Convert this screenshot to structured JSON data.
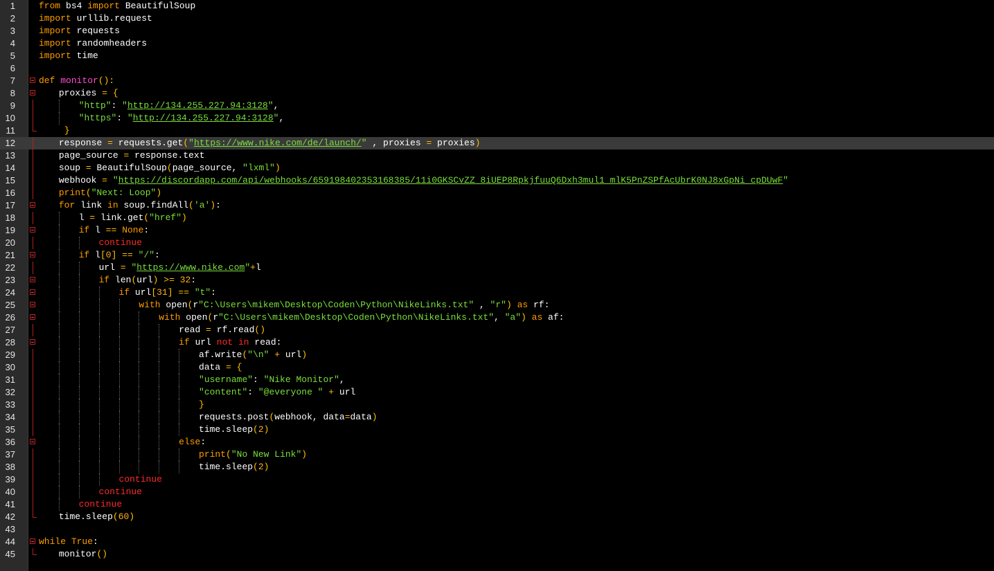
{
  "editor": {
    "current_line": 12,
    "lines": [
      {
        "n": "1",
        "indent": 0,
        "fold": "",
        "tokens": [
          [
            "kw",
            "from"
          ],
          [
            "p",
            " bs4 "
          ],
          [
            "kw",
            "import"
          ],
          [
            "p",
            " BeautifulSoup"
          ]
        ]
      },
      {
        "n": "2",
        "indent": 0,
        "fold": "",
        "tokens": [
          [
            "kw",
            "import"
          ],
          [
            "p",
            " urllib.request"
          ]
        ]
      },
      {
        "n": "3",
        "indent": 0,
        "fold": "",
        "tokens": [
          [
            "kw",
            "import"
          ],
          [
            "p",
            " requests"
          ]
        ]
      },
      {
        "n": "4",
        "indent": 0,
        "fold": "",
        "tokens": [
          [
            "kw",
            "import"
          ],
          [
            "p",
            " randomheaders"
          ]
        ]
      },
      {
        "n": "5",
        "indent": 0,
        "fold": "",
        "tokens": [
          [
            "kw",
            "import"
          ],
          [
            "p",
            " time"
          ]
        ]
      },
      {
        "n": "6",
        "indent": 0,
        "fold": "",
        "tokens": []
      },
      {
        "n": "7",
        "indent": 0,
        "fold": "open",
        "tokens": [
          [
            "kw",
            "def"
          ],
          [
            "p",
            " "
          ],
          [
            "fn",
            "monitor"
          ],
          [
            "br",
            "():"
          ]
        ]
      },
      {
        "n": "8",
        "indent": 1,
        "fold": "open",
        "tokens": [
          [
            "p",
            "proxies "
          ],
          [
            "op",
            "="
          ],
          [
            "p",
            " "
          ],
          [
            "br",
            "{"
          ]
        ]
      },
      {
        "n": "9",
        "indent": 2,
        "fold": "line",
        "tokens": [
          [
            "str",
            "\"http\""
          ],
          [
            "p",
            ": "
          ],
          [
            "str",
            "\""
          ],
          [
            "url",
            "http://134.255.227.94:3128"
          ],
          [
            "str",
            "\""
          ],
          [
            "p",
            ","
          ]
        ]
      },
      {
        "n": "10",
        "indent": 2,
        "fold": "line",
        "tokens": [
          [
            "str",
            "\"https\""
          ],
          [
            "p",
            ": "
          ],
          [
            "str",
            "\""
          ],
          [
            "url",
            "http://134.255.227.94:3128"
          ],
          [
            "str",
            "\""
          ],
          [
            "p",
            ","
          ]
        ]
      },
      {
        "n": "11",
        "indent": 1,
        "fold": "end",
        "tokens": [
          [
            "p",
            " "
          ],
          [
            "br",
            "}"
          ]
        ]
      },
      {
        "n": "12",
        "indent": 1,
        "fold": "line",
        "tokens": [
          [
            "p",
            "response "
          ],
          [
            "op",
            "="
          ],
          [
            "p",
            " requests.get"
          ],
          [
            "br",
            "("
          ],
          [
            "str",
            "\""
          ],
          [
            "url",
            "https://www.nike.com/de/launch/"
          ],
          [
            "str",
            "\""
          ],
          [
            "p",
            " , proxies "
          ],
          [
            "op",
            "="
          ],
          [
            "p",
            " proxies"
          ],
          [
            "br",
            ")"
          ]
        ]
      },
      {
        "n": "13",
        "indent": 1,
        "fold": "line",
        "tokens": [
          [
            "p",
            "page_source "
          ],
          [
            "op",
            "="
          ],
          [
            "p",
            " response.text"
          ]
        ]
      },
      {
        "n": "14",
        "indent": 1,
        "fold": "line",
        "tokens": [
          [
            "p",
            "soup "
          ],
          [
            "op",
            "="
          ],
          [
            "p",
            " BeautifulSoup"
          ],
          [
            "br",
            "("
          ],
          [
            "p",
            "page_source, "
          ],
          [
            "str",
            "\"lxml\""
          ],
          [
            "br",
            ")"
          ]
        ]
      },
      {
        "n": "15",
        "indent": 1,
        "fold": "line",
        "tokens": [
          [
            "p",
            "webhook "
          ],
          [
            "op",
            "="
          ],
          [
            "p",
            " "
          ],
          [
            "str",
            "\""
          ],
          [
            "url",
            "https://discordapp.com/api/webhooks/659198402353168385/11i0GKSCvZZ_8iUEP8RpkjfuuQ6Dxh3mul1_mlK5PnZSPfAcUbrK0NJ8xGpNi_cpDUwF"
          ],
          [
            "str",
            "\""
          ]
        ]
      },
      {
        "n": "16",
        "indent": 1,
        "fold": "line",
        "tokens": [
          [
            "kw",
            "print"
          ],
          [
            "br",
            "("
          ],
          [
            "str",
            "\"Next: Loop\""
          ],
          [
            "br",
            ")"
          ]
        ]
      },
      {
        "n": "17",
        "indent": 1,
        "fold": "open",
        "tokens": [
          [
            "kw",
            "for"
          ],
          [
            "p",
            " link "
          ],
          [
            "kw",
            "in"
          ],
          [
            "p",
            " soup.findAll"
          ],
          [
            "br",
            "("
          ],
          [
            "str",
            "'a'"
          ],
          [
            "br",
            ")"
          ],
          [
            "p",
            ":"
          ]
        ]
      },
      {
        "n": "18",
        "indent": 2,
        "fold": "line",
        "tokens": [
          [
            "p",
            "l "
          ],
          [
            "op",
            "="
          ],
          [
            "p",
            " link.get"
          ],
          [
            "br",
            "("
          ],
          [
            "str",
            "\"href\""
          ],
          [
            "br",
            ")"
          ]
        ]
      },
      {
        "n": "19",
        "indent": 2,
        "fold": "open",
        "tokens": [
          [
            "kw",
            "if"
          ],
          [
            "p",
            " l "
          ],
          [
            "op",
            "=="
          ],
          [
            "p",
            " "
          ],
          [
            "kw",
            "None"
          ],
          [
            "p",
            ":"
          ]
        ]
      },
      {
        "n": "20",
        "indent": 3,
        "fold": "line",
        "tokens": [
          [
            "kw2",
            "continue"
          ]
        ]
      },
      {
        "n": "21",
        "indent": 2,
        "fold": "open",
        "tokens": [
          [
            "kw",
            "if"
          ],
          [
            "p",
            " l"
          ],
          [
            "br",
            "["
          ],
          [
            "num",
            "0"
          ],
          [
            "br",
            "]"
          ],
          [
            "p",
            " "
          ],
          [
            "op",
            "=="
          ],
          [
            "p",
            " "
          ],
          [
            "str",
            "\"/\""
          ],
          [
            "p",
            ":"
          ]
        ]
      },
      {
        "n": "22",
        "indent": 3,
        "fold": "line",
        "tokens": [
          [
            "p",
            "url "
          ],
          [
            "op",
            "="
          ],
          [
            "p",
            " "
          ],
          [
            "str",
            "\""
          ],
          [
            "url",
            "https://www.nike.com"
          ],
          [
            "str",
            "\""
          ],
          [
            "op",
            "+"
          ],
          [
            "p",
            "l"
          ]
        ]
      },
      {
        "n": "23",
        "indent": 3,
        "fold": "open",
        "tokens": [
          [
            "kw",
            "if"
          ],
          [
            "p",
            " len"
          ],
          [
            "br",
            "("
          ],
          [
            "p",
            "url"
          ],
          [
            "br",
            ")"
          ],
          [
            "p",
            " "
          ],
          [
            "op",
            ">="
          ],
          [
            "p",
            " "
          ],
          [
            "num",
            "32"
          ],
          [
            "p",
            ":"
          ]
        ]
      },
      {
        "n": "24",
        "indent": 4,
        "fold": "open",
        "tokens": [
          [
            "kw",
            "if"
          ],
          [
            "p",
            " url"
          ],
          [
            "br",
            "["
          ],
          [
            "num",
            "31"
          ],
          [
            "br",
            "]"
          ],
          [
            "p",
            " "
          ],
          [
            "op",
            "=="
          ],
          [
            "p",
            " "
          ],
          [
            "str",
            "\"t\""
          ],
          [
            "p",
            ":"
          ]
        ]
      },
      {
        "n": "25",
        "indent": 5,
        "fold": "open",
        "tokens": [
          [
            "kw",
            "with"
          ],
          [
            "p",
            " open"
          ],
          [
            "br",
            "("
          ],
          [
            "p",
            "r"
          ],
          [
            "str",
            "\"C:\\Users\\mikem\\Desktop\\Coden\\Python\\NikeLinks.txt\""
          ],
          [
            "p",
            " , "
          ],
          [
            "str",
            "\"r\""
          ],
          [
            "br",
            ")"
          ],
          [
            "p",
            " "
          ],
          [
            "kw",
            "as"
          ],
          [
            "p",
            " rf:"
          ]
        ]
      },
      {
        "n": "26",
        "indent": 6,
        "fold": "open",
        "tokens": [
          [
            "kw",
            "with"
          ],
          [
            "p",
            " open"
          ],
          [
            "br",
            "("
          ],
          [
            "p",
            "r"
          ],
          [
            "str",
            "\"C:\\Users\\mikem\\Desktop\\Coden\\Python\\NikeLinks.txt\""
          ],
          [
            "p",
            ", "
          ],
          [
            "str",
            "\"a\""
          ],
          [
            "br",
            ")"
          ],
          [
            "p",
            " "
          ],
          [
            "kw",
            "as"
          ],
          [
            "p",
            " af:"
          ]
        ]
      },
      {
        "n": "27",
        "indent": 7,
        "fold": "line",
        "tokens": [
          [
            "p",
            "read "
          ],
          [
            "op",
            "="
          ],
          [
            "p",
            " rf.read"
          ],
          [
            "br",
            "()"
          ]
        ]
      },
      {
        "n": "28",
        "indent": 7,
        "fold": "open",
        "tokens": [
          [
            "kw",
            "if"
          ],
          [
            "p",
            " url "
          ],
          [
            "kw2",
            "not"
          ],
          [
            "p",
            " "
          ],
          [
            "kw2",
            "in"
          ],
          [
            "p",
            " read:"
          ]
        ]
      },
      {
        "n": "29",
        "indent": 8,
        "fold": "line",
        "tokens": [
          [
            "p",
            "af.write"
          ],
          [
            "br",
            "("
          ],
          [
            "str",
            "\"\\n\""
          ],
          [
            "p",
            " "
          ],
          [
            "op",
            "+"
          ],
          [
            "p",
            " url"
          ],
          [
            "br",
            ")"
          ]
        ]
      },
      {
        "n": "30",
        "indent": 8,
        "fold": "line",
        "tokens": [
          [
            "p",
            "data "
          ],
          [
            "op",
            "="
          ],
          [
            "p",
            " "
          ],
          [
            "br",
            "{"
          ]
        ]
      },
      {
        "n": "31",
        "indent": 8,
        "fold": "line",
        "tokens": [
          [
            "str",
            "\"username\""
          ],
          [
            "p",
            ": "
          ],
          [
            "str",
            "\"Nike Monitor\""
          ],
          [
            "p",
            ","
          ]
        ]
      },
      {
        "n": "32",
        "indent": 8,
        "fold": "line",
        "tokens": [
          [
            "str",
            "\"content\""
          ],
          [
            "p",
            ": "
          ],
          [
            "str",
            "\"@everyone \""
          ],
          [
            "p",
            " "
          ],
          [
            "op",
            "+"
          ],
          [
            "p",
            " url"
          ]
        ]
      },
      {
        "n": "33",
        "indent": 8,
        "fold": "line",
        "tokens": [
          [
            "br",
            "}"
          ]
        ]
      },
      {
        "n": "34",
        "indent": 8,
        "fold": "line",
        "tokens": [
          [
            "p",
            "requests.post"
          ],
          [
            "br",
            "("
          ],
          [
            "p",
            "webhook, data"
          ],
          [
            "op",
            "="
          ],
          [
            "p",
            "data"
          ],
          [
            "br",
            ")"
          ]
        ]
      },
      {
        "n": "35",
        "indent": 8,
        "fold": "line",
        "tokens": [
          [
            "p",
            "time.sleep"
          ],
          [
            "br",
            "("
          ],
          [
            "num",
            "2"
          ],
          [
            "br",
            ")"
          ]
        ]
      },
      {
        "n": "36",
        "indent": 7,
        "fold": "open",
        "tokens": [
          [
            "kw",
            "else"
          ],
          [
            "p",
            ":"
          ]
        ]
      },
      {
        "n": "37",
        "indent": 8,
        "fold": "line",
        "tokens": [
          [
            "kw",
            "print"
          ],
          [
            "br",
            "("
          ],
          [
            "str",
            "\"No New Link\""
          ],
          [
            "br",
            ")"
          ]
        ]
      },
      {
        "n": "38",
        "indent": 8,
        "fold": "line",
        "tokens": [
          [
            "p",
            "time.sleep"
          ],
          [
            "br",
            "("
          ],
          [
            "num",
            "2"
          ],
          [
            "br",
            ")"
          ]
        ]
      },
      {
        "n": "39",
        "indent": 4,
        "fold": "line",
        "tokens": [
          [
            "kw2",
            "continue"
          ]
        ]
      },
      {
        "n": "40",
        "indent": 3,
        "fold": "line",
        "tokens": [
          [
            "kw2",
            "continue"
          ]
        ]
      },
      {
        "n": "41",
        "indent": 2,
        "fold": "line",
        "tokens": [
          [
            "kw2",
            "continue"
          ]
        ]
      },
      {
        "n": "42",
        "indent": 1,
        "fold": "end",
        "tokens": [
          [
            "p",
            "time.sleep"
          ],
          [
            "br",
            "("
          ],
          [
            "num",
            "60"
          ],
          [
            "br",
            ")"
          ]
        ]
      },
      {
        "n": "43",
        "indent": 0,
        "fold": "",
        "tokens": []
      },
      {
        "n": "44",
        "indent": 0,
        "fold": "open",
        "tokens": [
          [
            "kw",
            "while"
          ],
          [
            "p",
            " "
          ],
          [
            "kw",
            "True"
          ],
          [
            "p",
            ":"
          ]
        ]
      },
      {
        "n": "45",
        "indent": 1,
        "fold": "end",
        "tokens": [
          [
            "p",
            "monitor"
          ],
          [
            "br",
            "()"
          ]
        ]
      }
    ]
  },
  "colors": {
    "background": "#000000",
    "gutter": "#2b2b2b",
    "keyword": "#ff9d00",
    "keyword_alt": "#ff2a2a",
    "function_name": "#ff4dd2",
    "string": "#7adf3b",
    "number": "#ffb020",
    "current_line": "#3a3a3a"
  }
}
